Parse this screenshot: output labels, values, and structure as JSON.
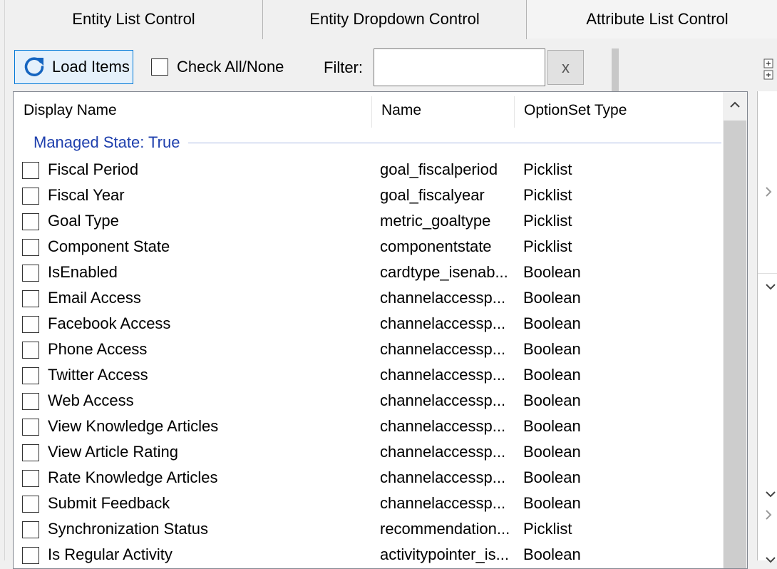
{
  "tabs": [
    {
      "label": "Entity List Control",
      "selected": false
    },
    {
      "label": "Entity Dropdown Control",
      "selected": false
    },
    {
      "label": "Attribute List Control",
      "selected": true
    }
  ],
  "toolbar": {
    "load_label": "Load Items",
    "load_icon": "refresh-icon",
    "check_all_label": "Check All/None",
    "filter_label": "Filter:",
    "filter_value": "",
    "clear_label": "x"
  },
  "list": {
    "columns": [
      "Display Name",
      "Name",
      "OptionSet Type"
    ],
    "group_header": "Managed State: True",
    "rows": [
      {
        "display": "Fiscal Period",
        "name": "goal_fiscalperiod",
        "type": "Picklist"
      },
      {
        "display": "Fiscal Year",
        "name": "goal_fiscalyear",
        "type": "Picklist"
      },
      {
        "display": "Goal Type",
        "name": "metric_goaltype",
        "type": "Picklist"
      },
      {
        "display": "Component State",
        "name": "componentstate",
        "type": "Picklist"
      },
      {
        "display": "IsEnabled",
        "name": "cardtype_isenab...",
        "type": "Boolean"
      },
      {
        "display": "Email Access",
        "name": "channelaccessp...",
        "type": "Boolean"
      },
      {
        "display": "Facebook Access",
        "name": "channelaccessp...",
        "type": "Boolean"
      },
      {
        "display": "Phone Access",
        "name": "channelaccessp...",
        "type": "Boolean"
      },
      {
        "display": "Twitter Access",
        "name": "channelaccessp...",
        "type": "Boolean"
      },
      {
        "display": "Web Access",
        "name": "channelaccessp...",
        "type": "Boolean"
      },
      {
        "display": "View Knowledge Articles",
        "name": "channelaccessp...",
        "type": "Boolean"
      },
      {
        "display": "View Article Rating",
        "name": "channelaccessp...",
        "type": "Boolean"
      },
      {
        "display": "Rate Knowledge Articles",
        "name": "channelaccessp...",
        "type": "Boolean"
      },
      {
        "display": "Submit Feedback",
        "name": "channelaccessp...",
        "type": "Boolean"
      },
      {
        "display": "Synchronization Status",
        "name": "recommendation...",
        "type": "Picklist"
      },
      {
        "display": "Is Regular Activity",
        "name": "activitypointer_is...",
        "type": "Boolean"
      }
    ]
  },
  "icons": {
    "scroll_up": "chevron-up-icon",
    "tree": "tree-expand-icon",
    "side_right": "chevron-right-icon",
    "side_down": "chevron-down-icon"
  },
  "colors": {
    "accent": "#0078d7",
    "group_text": "#1e3fad",
    "background": "#f0f0f0"
  }
}
